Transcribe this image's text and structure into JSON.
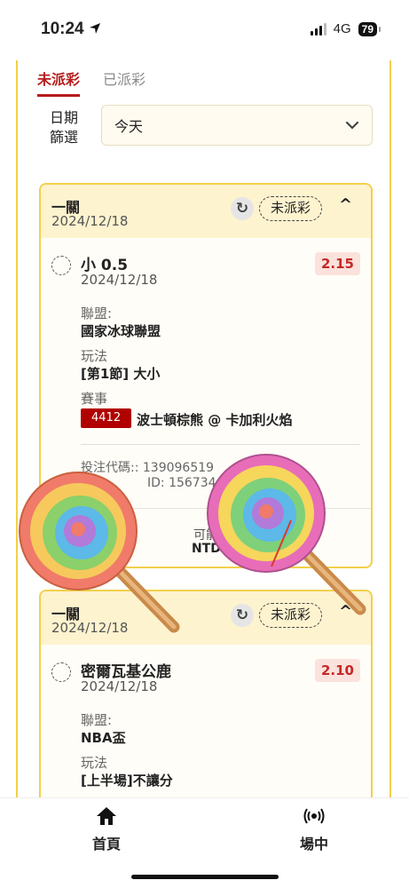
{
  "status_bar": {
    "time": "10:24",
    "network": "4G",
    "battery": "79"
  },
  "tabs": [
    {
      "label": "未派彩",
      "active": true
    },
    {
      "label": "已派彩",
      "active": false
    }
  ],
  "filter": {
    "label": "日期篩選",
    "selected": "今天"
  },
  "cards": [
    {
      "title": "一關",
      "date": "2024/12/18",
      "status": "未派彩",
      "bet": {
        "name": "小 0.5",
        "date": "2024/12/18",
        "odds": "2.15",
        "league_label": "聯盟:",
        "league": "國家冰球聯盟",
        "play_label": "玩法",
        "play": "[第1節] 大小",
        "match_label": "賽事",
        "match_id": "4412",
        "match": "波士頓棕熊 @ 卡加利火焰",
        "code": "投注代碼:: 139096519",
        "ref_id": "ID: 156734434.1",
        "payout_label": "可能",
        "payout_value": "NTD"
      }
    },
    {
      "title": "一關",
      "date": "2024/12/18",
      "status": "未派彩",
      "bet": {
        "name": "密爾瓦基公鹿",
        "date": "2024/12/18",
        "odds": "2.10",
        "league_label": "聯盟:",
        "league": "NBA盃",
        "play_label": "玩法",
        "play": "[上半場]不讓分"
      }
    }
  ],
  "tabbar": {
    "items": [
      {
        "label": "首頁",
        "icon": "home-icon"
      },
      {
        "label": "場中",
        "icon": "live-signal-icon"
      }
    ]
  },
  "colors": {
    "accent": "#b71c1c",
    "card_border": "#f2d04a",
    "card_header": "#fdf3cf"
  }
}
